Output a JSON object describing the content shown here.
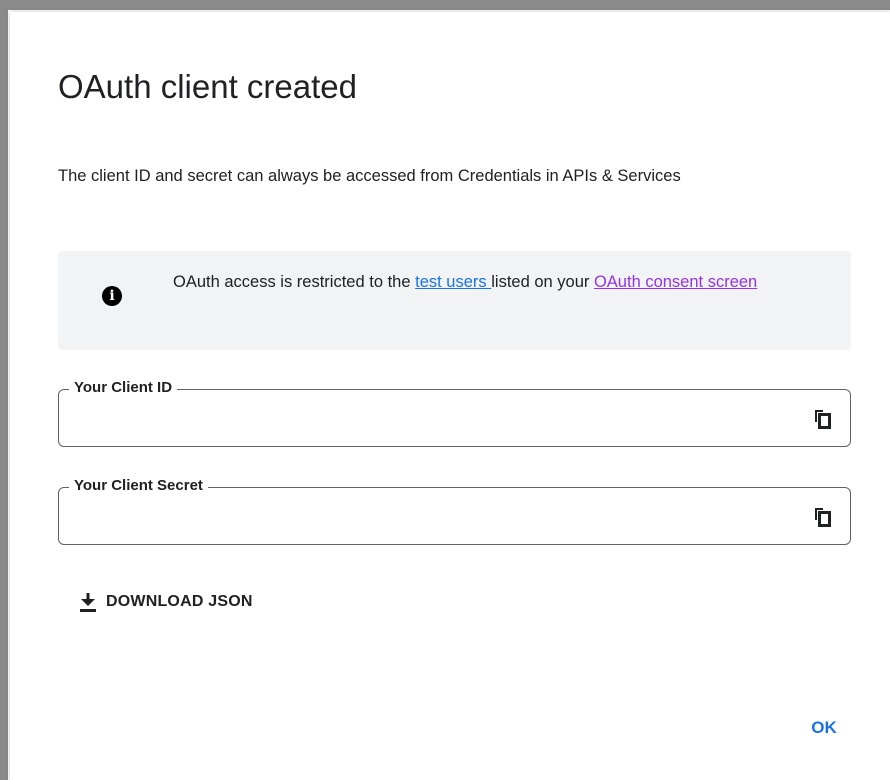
{
  "dialog": {
    "title": "OAuth client created",
    "description": "The client ID and secret can always be accessed from Credentials in APIs & Services"
  },
  "notice": {
    "icon": "info-icon",
    "text_before": "OAuth access is restricted to the ",
    "link_test_users": "test users ",
    "text_middle": "listed on your ",
    "link_consent_screen": "OAuth consent screen"
  },
  "fields": {
    "client_id": {
      "label": "Your Client ID",
      "value": "",
      "copy_icon": "copy-icon"
    },
    "client_secret": {
      "label": "Your Client Secret",
      "value": "",
      "copy_icon": "copy-icon"
    }
  },
  "actions": {
    "download_label": "DOWNLOAD JSON",
    "download_icon": "download-icon",
    "ok_label": "OK"
  },
  "colors": {
    "link_blue": "#1a73e8",
    "link_visited": "#9334e6",
    "notice_bg": "#f1f3f4",
    "text": "#202124"
  }
}
